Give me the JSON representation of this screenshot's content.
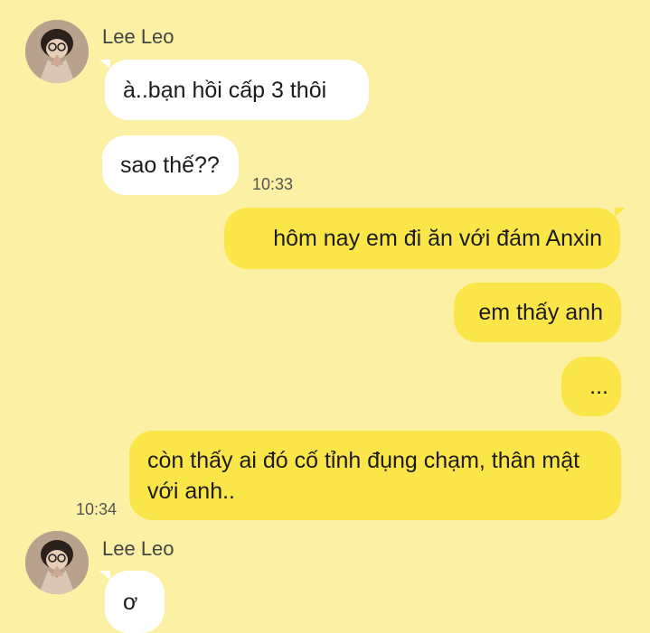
{
  "messages": [
    {
      "type": "incoming",
      "sender": "Lee Leo",
      "text": "à..bạn hồi cấp 3 thôi"
    },
    {
      "type": "incoming",
      "text": "sao thế??",
      "time": "10:33"
    },
    {
      "type": "outgoing",
      "text": "hôm nay em đi ăn với đám Anxin"
    },
    {
      "type": "outgoing",
      "text": "em thấy anh"
    },
    {
      "type": "outgoing",
      "text": "..."
    },
    {
      "type": "outgoing",
      "text": "còn thấy ai đó cố tỉnh đụng chạm, thân mật với anh..",
      "time": "10:34"
    },
    {
      "type": "incoming",
      "sender": "Lee Leo",
      "text": "ơ"
    }
  ],
  "colors": {
    "background": "#fcf0a4",
    "incoming_bubble": "#ffffff",
    "outgoing_bubble": "#fbe64a"
  }
}
